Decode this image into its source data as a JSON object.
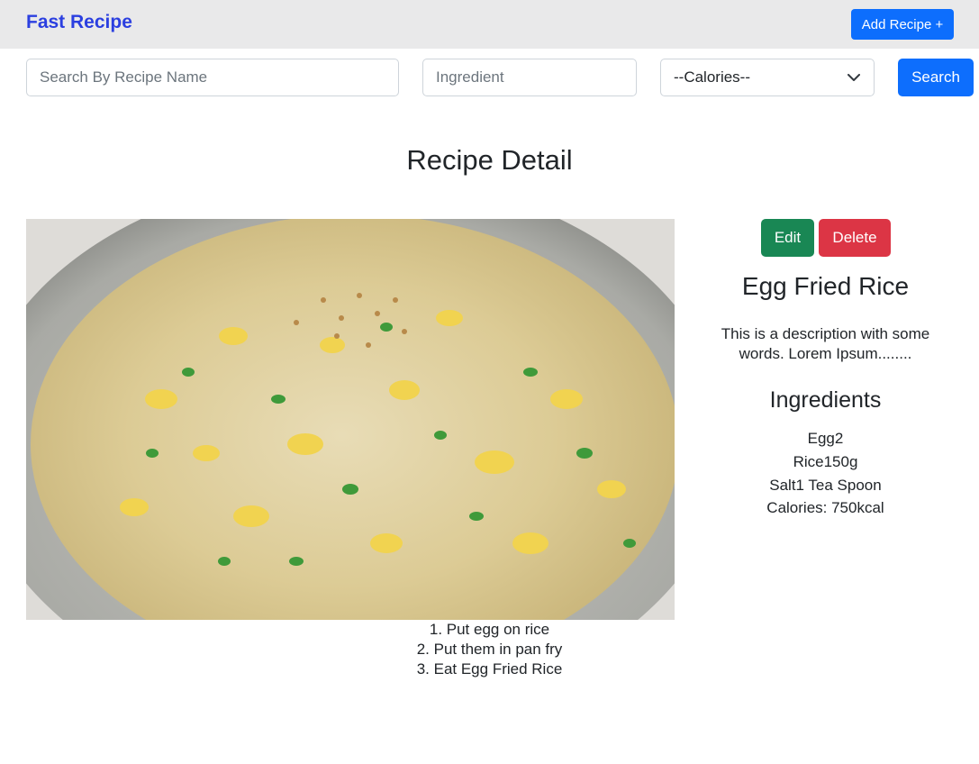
{
  "navbar": {
    "brand": "Fast Recipe",
    "add_recipe_label": "Add Recipe +"
  },
  "search": {
    "name_placeholder": "Search By Recipe Name",
    "ingredient_placeholder": "Ingredient",
    "calories_selected": "--Calories--",
    "search_label": "Search"
  },
  "page": {
    "title": "Recipe Detail"
  },
  "recipe": {
    "name": "Egg Fried Rice",
    "description": "This is a description with some words. Lorem Ipsum........",
    "ingredients_title": "Ingredients",
    "ingredients": [
      "Egg2",
      "Rice150g",
      "Salt1 Tea Spoon"
    ],
    "calories": "Calories: 750kcal",
    "steps": [
      "1. Put egg on rice",
      "2. Put them in pan fry",
      "3. Eat Egg Fried Rice"
    ]
  },
  "actions": {
    "edit_label": "Edit",
    "delete_label": "Delete"
  },
  "colors": {
    "primary": "#0d6efd",
    "success": "#198754",
    "danger": "#dc3545",
    "brand": "#2b3fe0"
  },
  "icons": {
    "calories_select": "chevron-down-icon"
  }
}
